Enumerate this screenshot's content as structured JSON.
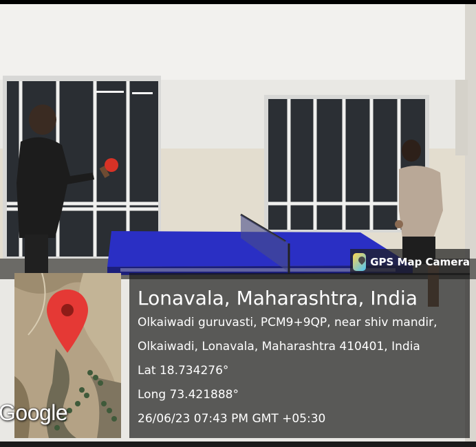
{
  "badge": {
    "text": "GPS Map Camera",
    "icon": "gps-map-camera-app-icon"
  },
  "location": {
    "title": "Lonavala, Maharashtra, India",
    "address_line1": "Olkaiwadi guruvasti, PCM9+9QP, near shiv mandir,",
    "address_line2": "Olkaiwadi, Lonavala, Maharashtra 410401, India",
    "lat": "Lat 18.734276°",
    "long": "Long 73.421888°",
    "datetime": "26/06/23 07:43 PM GMT +05:30"
  },
  "map": {
    "watermark": "Google",
    "pin_color": "#e53935"
  },
  "colors": {
    "table_blue": "#2a2fc4",
    "wall": "#eceae6"
  }
}
